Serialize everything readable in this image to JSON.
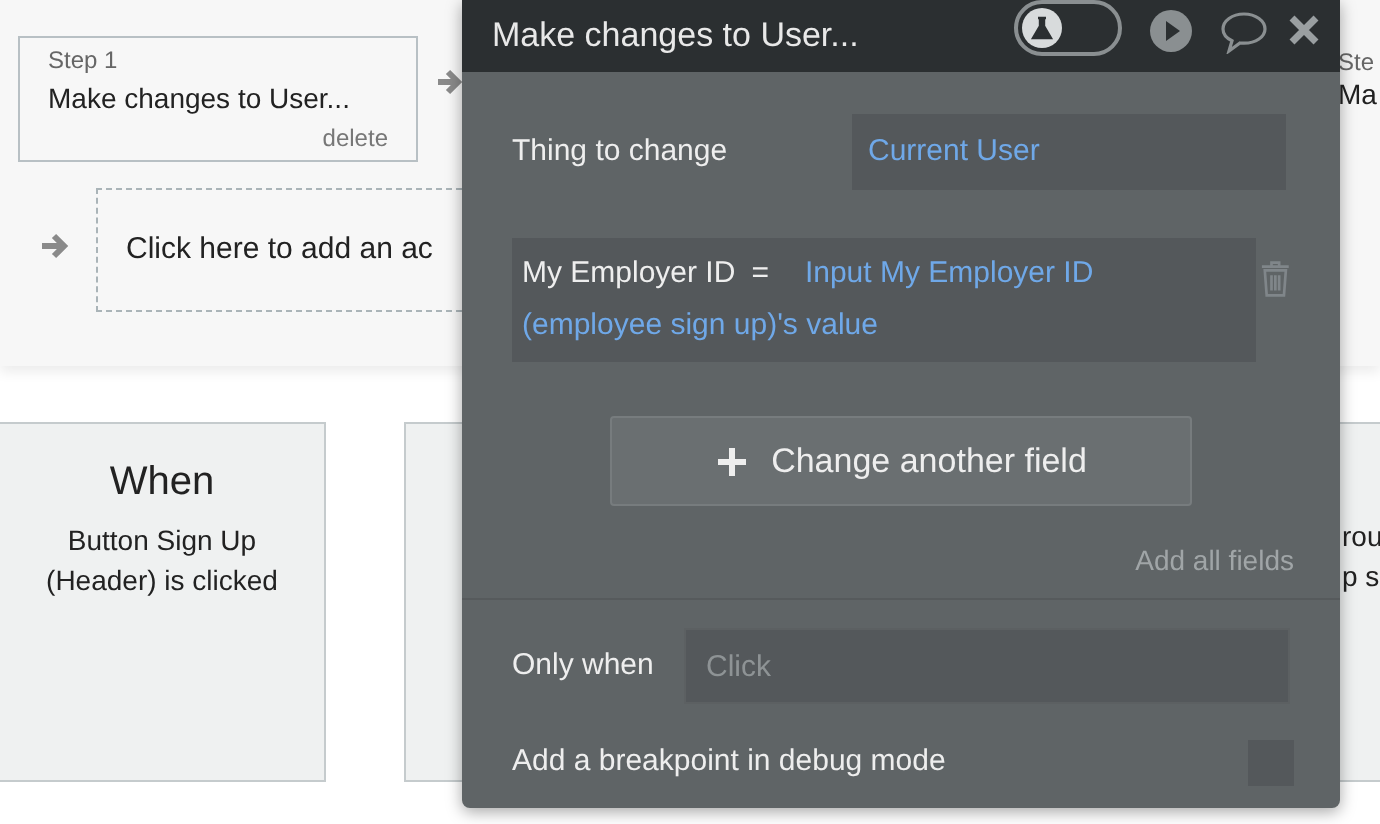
{
  "workflow": {
    "step": {
      "label": "Step 1",
      "title": "Make changes to User...",
      "delete": "delete"
    },
    "add_action": "Click here to add an ac",
    "when_card": {
      "title": "When",
      "event": "Button Sign Up (Header) is clicked"
    },
    "right_step": {
      "label": "Ste",
      "title": "Ma"
    },
    "right_card": {
      "line_1": "rou",
      "line_2": "p s"
    }
  },
  "panel": {
    "title": "Make changes to User...",
    "debug_toggle": {
      "on": false
    },
    "thing_to_change": {
      "label": "Thing to change",
      "value": "Current User"
    },
    "fields": [
      {
        "name": "My Employer ID",
        "operator": "=",
        "value": "Input My Employer ID (employee sign up)'s value"
      }
    ],
    "change_another": "Change another field",
    "add_all": "Add all fields",
    "only_when": {
      "label": "Only when",
      "placeholder": "Click"
    },
    "breakpoint": {
      "label": "Add a breakpoint in debug mode",
      "checked": false
    }
  }
}
